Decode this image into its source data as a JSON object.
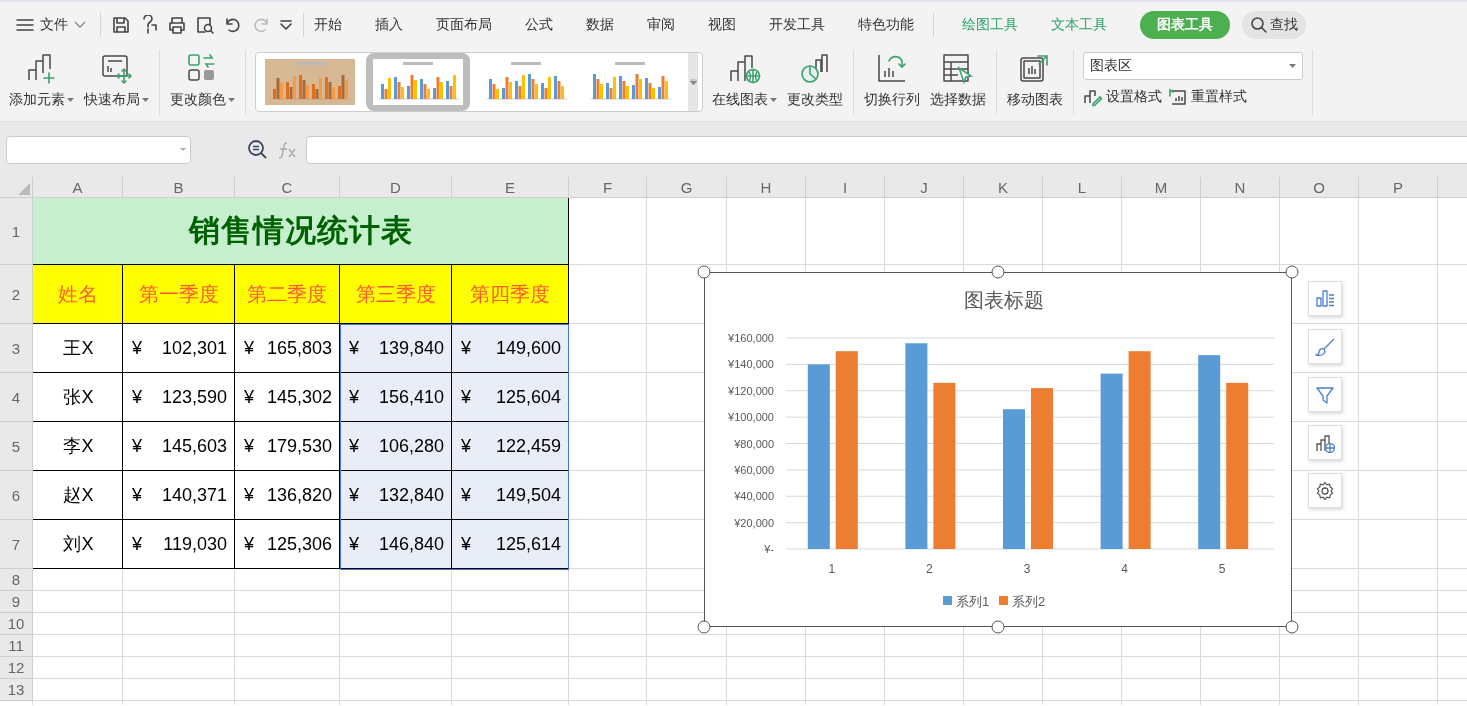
{
  "menubar": {
    "file_menu": "文件",
    "tabs": [
      {
        "label": "开始",
        "kind": "main",
        "selected": false
      },
      {
        "label": "插入",
        "kind": "main",
        "selected": false
      },
      {
        "label": "页面布局",
        "kind": "main",
        "selected": false
      },
      {
        "label": "公式",
        "kind": "main",
        "selected": false
      },
      {
        "label": "数据",
        "kind": "main",
        "selected": false
      },
      {
        "label": "审阅",
        "kind": "main",
        "selected": false
      },
      {
        "label": "视图",
        "kind": "main",
        "selected": false
      },
      {
        "label": "开发工具",
        "kind": "main",
        "selected": false
      },
      {
        "label": "特色功能",
        "kind": "main",
        "selected": false
      },
      {
        "label": "绘图工具",
        "kind": "context",
        "selected": false
      },
      {
        "label": "文本工具",
        "kind": "context",
        "selected": false
      },
      {
        "label": "图表工具",
        "kind": "context",
        "selected": true
      }
    ],
    "search": "查找"
  },
  "ribbon": {
    "tools": [
      {
        "label": "添加元素",
        "dropdown": true
      },
      {
        "label": "快速布局",
        "dropdown": true
      },
      {
        "label": "更改颜色",
        "dropdown": true
      }
    ],
    "styles": [
      {
        "selected": false
      },
      {
        "selected": true
      },
      {
        "selected": false
      },
      {
        "selected": false
      }
    ],
    "tools2": [
      {
        "label": "在线图表",
        "dropdown": true
      },
      {
        "label": "更改类型",
        "dropdown": false
      },
      {
        "label": "切换行列",
        "dropdown": false
      },
      {
        "label": "选择数据",
        "dropdown": false
      },
      {
        "label": "移动图表",
        "dropdown": false
      }
    ],
    "element_select": "图表区",
    "format_buttons": [
      "设置格式",
      "重置样式"
    ]
  },
  "sheet": {
    "columns": [
      "A",
      "B",
      "C",
      "D",
      "E",
      "F",
      "G",
      "H",
      "I",
      "J",
      "K",
      "L",
      "M",
      "N",
      "O",
      "P"
    ],
    "row_numbers": [
      "1",
      "2",
      "3",
      "4",
      "5",
      "6",
      "7",
      "8",
      "9",
      "10",
      "11",
      "12",
      "13"
    ],
    "title": "销售情况统计表",
    "headers": [
      "姓名",
      "第一季度",
      "第二季度",
      "第三季度",
      "第四季度"
    ],
    "rows": [
      {
        "cells": [
          {
            "kind": "text",
            "text": "王X",
            "selected": false
          },
          {
            "kind": "money",
            "symbol": "¥",
            "amount": "102,301",
            "selected": false
          },
          {
            "kind": "money",
            "symbol": "¥",
            "amount": "165,803",
            "selected": false
          },
          {
            "kind": "money",
            "symbol": "¥",
            "amount": "139,840",
            "selected": true
          },
          {
            "kind": "money",
            "symbol": "¥",
            "amount": "149,600",
            "selected": true
          }
        ]
      },
      {
        "cells": [
          {
            "kind": "text",
            "text": "张X",
            "selected": false
          },
          {
            "kind": "money",
            "symbol": "¥",
            "amount": "123,590",
            "selected": false
          },
          {
            "kind": "money",
            "symbol": "¥",
            "amount": "145,302",
            "selected": false
          },
          {
            "kind": "money",
            "symbol": "¥",
            "amount": "156,410",
            "selected": true
          },
          {
            "kind": "money",
            "symbol": "¥",
            "amount": "125,604",
            "selected": true
          }
        ]
      },
      {
        "cells": [
          {
            "kind": "text",
            "text": "李X",
            "selected": false
          },
          {
            "kind": "money",
            "symbol": "¥",
            "amount": "145,603",
            "selected": false
          },
          {
            "kind": "money",
            "symbol": "¥",
            "amount": "179,530",
            "selected": false
          },
          {
            "kind": "money",
            "symbol": "¥",
            "amount": "106,280",
            "selected": true
          },
          {
            "kind": "money",
            "symbol": "¥",
            "amount": "122,459",
            "selected": true
          }
        ]
      },
      {
        "cells": [
          {
            "kind": "text",
            "text": "赵X",
            "selected": false
          },
          {
            "kind": "money",
            "symbol": "¥",
            "amount": "140,371",
            "selected": false
          },
          {
            "kind": "money",
            "symbol": "¥",
            "amount": "136,820",
            "selected": false
          },
          {
            "kind": "money",
            "symbol": "¥",
            "amount": "132,840",
            "selected": true
          },
          {
            "kind": "money",
            "symbol": "¥",
            "amount": "149,504",
            "selected": true
          }
        ]
      },
      {
        "cells": [
          {
            "kind": "text",
            "text": "刘X",
            "selected": false
          },
          {
            "kind": "money",
            "symbol": "¥",
            "amount": "119,030",
            "selected": false
          },
          {
            "kind": "money",
            "symbol": "¥",
            "amount": "125,306",
            "selected": false
          },
          {
            "kind": "money",
            "symbol": "¥",
            "amount": "146,840",
            "selected": true
          },
          {
            "kind": "money",
            "symbol": "¥",
            "amount": "125,614",
            "selected": true
          }
        ]
      }
    ]
  },
  "chart": {
    "selected": true,
    "chart_data": {
      "type": "bar",
      "title": "图表标题",
      "categories": [
        "1",
        "2",
        "3",
        "4",
        "5"
      ],
      "grid": true,
      "legend": true,
      "series": [
        {
          "name": "系列1",
          "color": "#5b9bd5",
          "values": [
            140000,
            156000,
            106000,
            133000,
            147000
          ]
        },
        {
          "name": "系列2",
          "color": "#ed7d31",
          "values": [
            150000,
            126000,
            122000,
            150000,
            126000
          ]
        }
      ],
      "ylim": [
        0,
        160000
      ],
      "yticks": [
        {
          "value": 0,
          "label": "¥-"
        },
        {
          "value": 20000,
          "label": "¥20,000"
        },
        {
          "value": 40000,
          "label": "¥40,000"
        },
        {
          "value": 60000,
          "label": "¥60,000"
        },
        {
          "value": 80000,
          "label": "¥80,000"
        },
        {
          "value": 100000,
          "label": "¥100,000"
        },
        {
          "value": 120000,
          "label": "¥120,000"
        },
        {
          "value": 140000,
          "label": "¥140,000"
        },
        {
          "value": 160000,
          "label": "¥160,000"
        }
      ]
    }
  }
}
